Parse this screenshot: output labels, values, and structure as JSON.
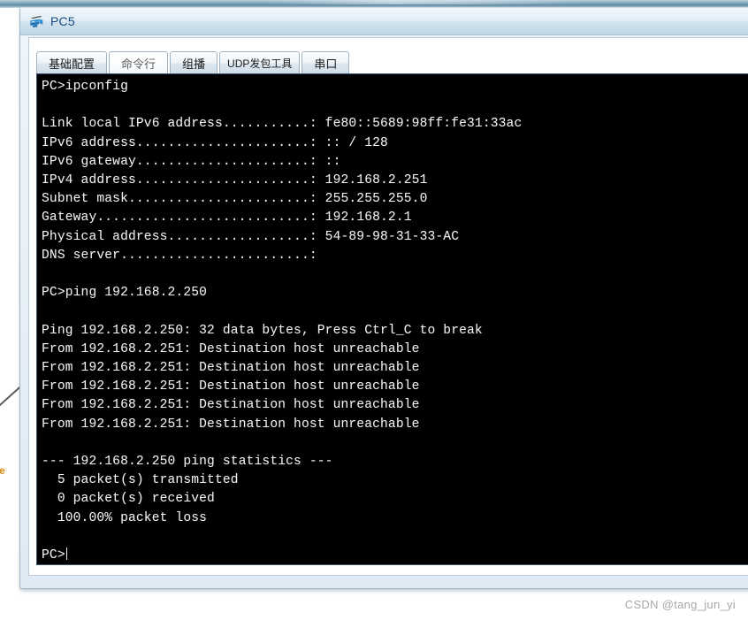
{
  "window": {
    "title": "PC5",
    "icon": "pc-host-icon"
  },
  "tabs": [
    {
      "label": "基础配置",
      "name": "tab-basic-config",
      "selected": false
    },
    {
      "label": "命令行",
      "name": "tab-command-line",
      "selected": true
    },
    {
      "label": "组播",
      "name": "tab-multicast",
      "selected": false
    },
    {
      "label": "UDP发包工具",
      "name": "tab-udp-sender",
      "selected": false
    },
    {
      "label": "串口",
      "name": "tab-serial-port",
      "selected": false
    }
  ],
  "terminal": {
    "prompt": "PC>",
    "lines": [
      "PC>ipconfig",
      "",
      "Link local IPv6 address...........: fe80::5689:98ff:fe31:33ac",
      "IPv6 address......................: :: / 128",
      "IPv6 gateway......................: ::",
      "IPv4 address......................: 192.168.2.251",
      "Subnet mask.......................: 255.255.255.0",
      "Gateway...........................: 192.168.2.1",
      "Physical address..................: 54-89-98-31-33-AC",
      "DNS server........................:",
      "",
      "PC>ping 192.168.2.250",
      "",
      "Ping 192.168.2.250: 32 data bytes, Press Ctrl_C to break",
      "From 192.168.2.251: Destination host unreachable",
      "From 192.168.2.251: Destination host unreachable",
      "From 192.168.2.251: Destination host unreachable",
      "From 192.168.2.251: Destination host unreachable",
      "From 192.168.2.251: Destination host unreachable",
      "",
      "--- 192.168.2.250 ping statistics ---",
      "  5 packet(s) transmitted",
      "  0 packet(s) received",
      "  100.00% packet loss",
      "",
      "PC>"
    ],
    "ipconfig": {
      "command": "ipconfig",
      "link_local_ipv6_address": "fe80::5689:98ff:fe31:33ac",
      "ipv6_address": ":: / 128",
      "ipv6_gateway": "::",
      "ipv4_address": "192.168.2.251",
      "subnet_mask": "255.255.255.0",
      "gateway": "192.168.2.1",
      "physical_address": "54-89-98-31-33-AC",
      "dns_server": ""
    },
    "ping": {
      "command": "ping 192.168.2.250",
      "target": "192.168.2.250",
      "data_bytes": "32",
      "break_hint": "Press Ctrl_C to break",
      "replies": [
        "From 192.168.2.251: Destination host unreachable",
        "From 192.168.2.251: Destination host unreachable",
        "From 192.168.2.251: Destination host unreachable",
        "From 192.168.2.251: Destination host unreachable",
        "From 192.168.2.251: Destination host unreachable"
      ],
      "statistics_header": "--- 192.168.2.250 ping statistics ---",
      "transmitted": "5 packet(s) transmitted",
      "received": "0 packet(s) received",
      "loss": "100.00% packet loss"
    }
  },
  "topology": {
    "link_label": "ne"
  },
  "watermark": {
    "text": "CSDN @tang_jun_yi"
  },
  "colors": {
    "terminal_background": "#000000",
    "terminal_text": "#f2f2ee",
    "title_text": "#17477e",
    "window_chrome": "#dfeaf4",
    "topology_label": "#e08a10",
    "watermark_text": "#a8a8a8"
  }
}
